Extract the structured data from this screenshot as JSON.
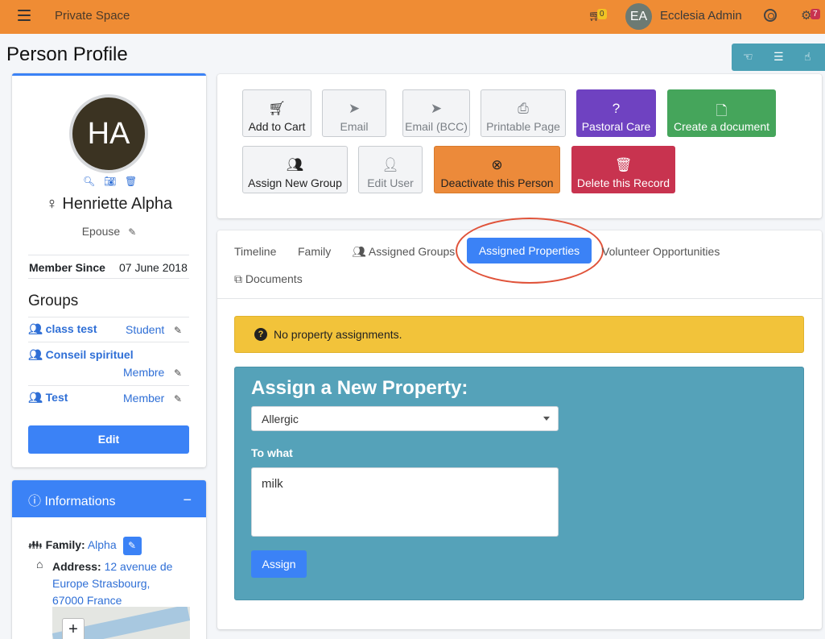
{
  "navbar": {
    "title": "Private Space",
    "cart_count": "0",
    "user_initials": "EA",
    "user_name": "Ecclesia Admin",
    "notifications_count": "7"
  },
  "page": {
    "title": "Person Profile"
  },
  "profile": {
    "initials": "HA",
    "name": "Henriette Alpha",
    "role": "Epouse",
    "member_since_label": "Member Since",
    "member_since_value": "07 June 2018",
    "groups_heading": "Groups",
    "groups": [
      {
        "name": "class test",
        "role": "Student"
      },
      {
        "name": "Conseil spirituel",
        "role": "Membre"
      },
      {
        "name": "Test",
        "role": "Member"
      }
    ],
    "edit_label": "Edit"
  },
  "info": {
    "heading": "Informations",
    "family_label": "Family:",
    "family_value": "Alpha",
    "address_label": "Address:",
    "address_line1": "12 avenue de",
    "address_line2": "Europe Strasbourg,",
    "address_line3": "67000 France",
    "map_zoom_in": "+"
  },
  "actions": [
    {
      "label": "Add to Cart",
      "icon": "cart-plus-icon"
    },
    {
      "label": "Email",
      "icon": "paper-plane-icon"
    },
    {
      "label": "Email (BCC)",
      "icon": "paper-plane-filled-icon"
    },
    {
      "label": "Printable Page",
      "icon": "printer-icon"
    },
    {
      "label": "Pastoral Care",
      "icon": "question-circle-icon"
    },
    {
      "label": "Create a document",
      "icon": "file-icon"
    },
    {
      "label": "Assign New Group",
      "icon": "users-icon"
    },
    {
      "label": "Edit User",
      "icon": "user-secret-icon"
    },
    {
      "label": "Deactivate this Person",
      "icon": "times-circle-icon"
    },
    {
      "label": "Delete this Record",
      "icon": "trash-icon"
    }
  ],
  "tabs": {
    "timeline": "Timeline",
    "family": "Family",
    "assigned_groups": "Assigned Groups",
    "assigned_properties": "Assigned Properties",
    "volunteer": "Volunteer Opportunities",
    "documents": "Documents"
  },
  "alert": {
    "text": "No property assignments."
  },
  "assign": {
    "title": "Assign a New Property:",
    "selected_property": "Allergic",
    "to_what_label": "To what",
    "to_what_value": "milk",
    "button": "Assign"
  },
  "colors": {
    "navbar": "#ef8c34",
    "primary": "#3b82f6",
    "info_box": "#55a2b9",
    "warning": "#f2c33a",
    "purple": "#6f42c1",
    "green": "#45a55b",
    "danger": "#c8334f",
    "highlight": "#e0533a"
  }
}
